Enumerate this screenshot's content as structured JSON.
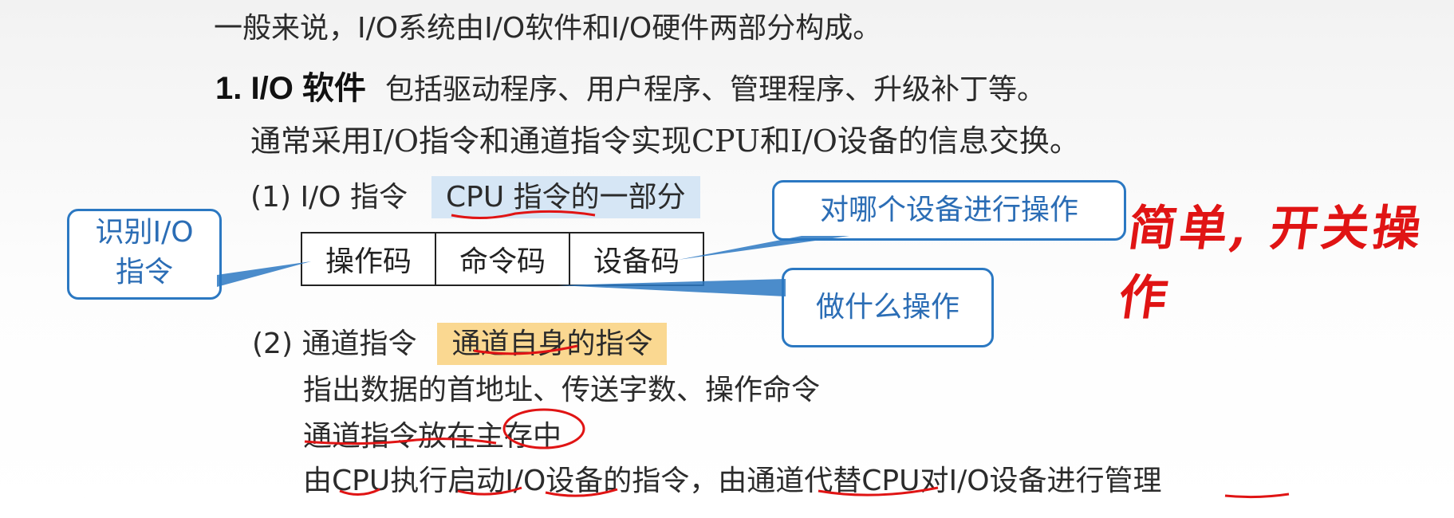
{
  "intro": "一般来说，I/O系统由I/O软件和I/O硬件两部分构成。",
  "section1": {
    "number_title": "1. I/O 软件",
    "desc": "包括驱动程序、用户程序、管理程序、升级补丁等。"
  },
  "serif_line": "通常采用I/O指令和通道指令实现CPU和I/O设备的信息交换。",
  "io_instruction": {
    "label": "(1) I/O 指令",
    "highlight": "CPU 指令的一部分",
    "format": [
      "操作码",
      "命令码",
      "设备码"
    ]
  },
  "callouts": {
    "identify": "识别I/O\n指令",
    "device": "对哪个设备进行操作",
    "operation": "做什么操作"
  },
  "handwriting": "简单, 开关操作",
  "channel_instruction": {
    "label": "(2) 通道指令",
    "highlight": "通道自身的指令",
    "details": [
      "指出数据的首地址、传送字数、操作命令",
      "通道指令放在主存中",
      "由CPU执行启动I/O设备的指令，由通道代替CPU对I/O设备进行管理"
    ]
  },
  "colors": {
    "callout_border": "#2b78c2",
    "callout_text": "#2b6db5",
    "blue_highlight": "#d6e6f5",
    "yellow_highlight": "#fad891",
    "ink_red": "#e01414"
  }
}
